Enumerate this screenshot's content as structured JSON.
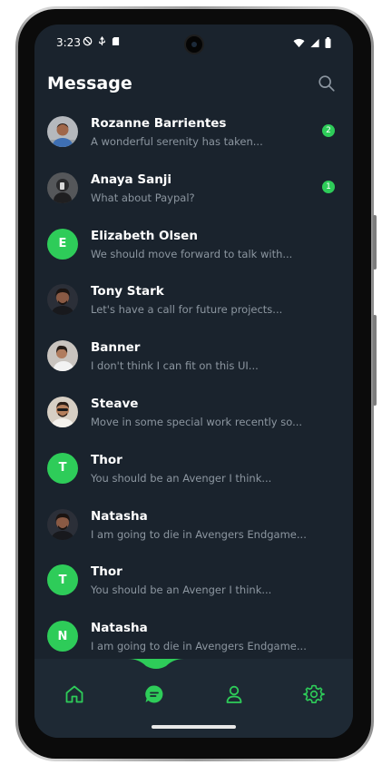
{
  "status": {
    "time": "3:23"
  },
  "header": {
    "title": "Message"
  },
  "conversations": [
    {
      "name": "Rozanne Barrientes",
      "preview": "A wonderful serenity has taken...",
      "badge": "2"
    },
    {
      "name": "Anaya Sanji",
      "preview": "What about Paypal?",
      "badge": "1"
    },
    {
      "name": "Elizabeth Olsen",
      "preview": "We should move forward to talk with...",
      "initial": "E"
    },
    {
      "name": "Tony Stark",
      "preview": "Let's have a call for future projects..."
    },
    {
      "name": "Banner",
      "preview": "I don't think I can fit on this UI..."
    },
    {
      "name": "Steave",
      "preview": "Move in some special work recently so..."
    },
    {
      "name": "Thor",
      "preview": "You should be an Avenger I think...",
      "initial": "T"
    },
    {
      "name": "Natasha",
      "preview": "I am going to die in Avengers Endgame..."
    },
    {
      "name": "Thor",
      "preview": "You should be an Avenger I think...",
      "initial": "T"
    },
    {
      "name": "Natasha",
      "preview": "I am going to die in Avengers Endgame...",
      "initial": "N"
    }
  ],
  "theme": {
    "accent": "#2ecc59",
    "background": "#1a232d",
    "nav_background": "#1e2934"
  },
  "nav": {
    "items": [
      "home-icon",
      "chat-icon",
      "user-icon",
      "settings-icon"
    ],
    "active": "chat-icon"
  }
}
